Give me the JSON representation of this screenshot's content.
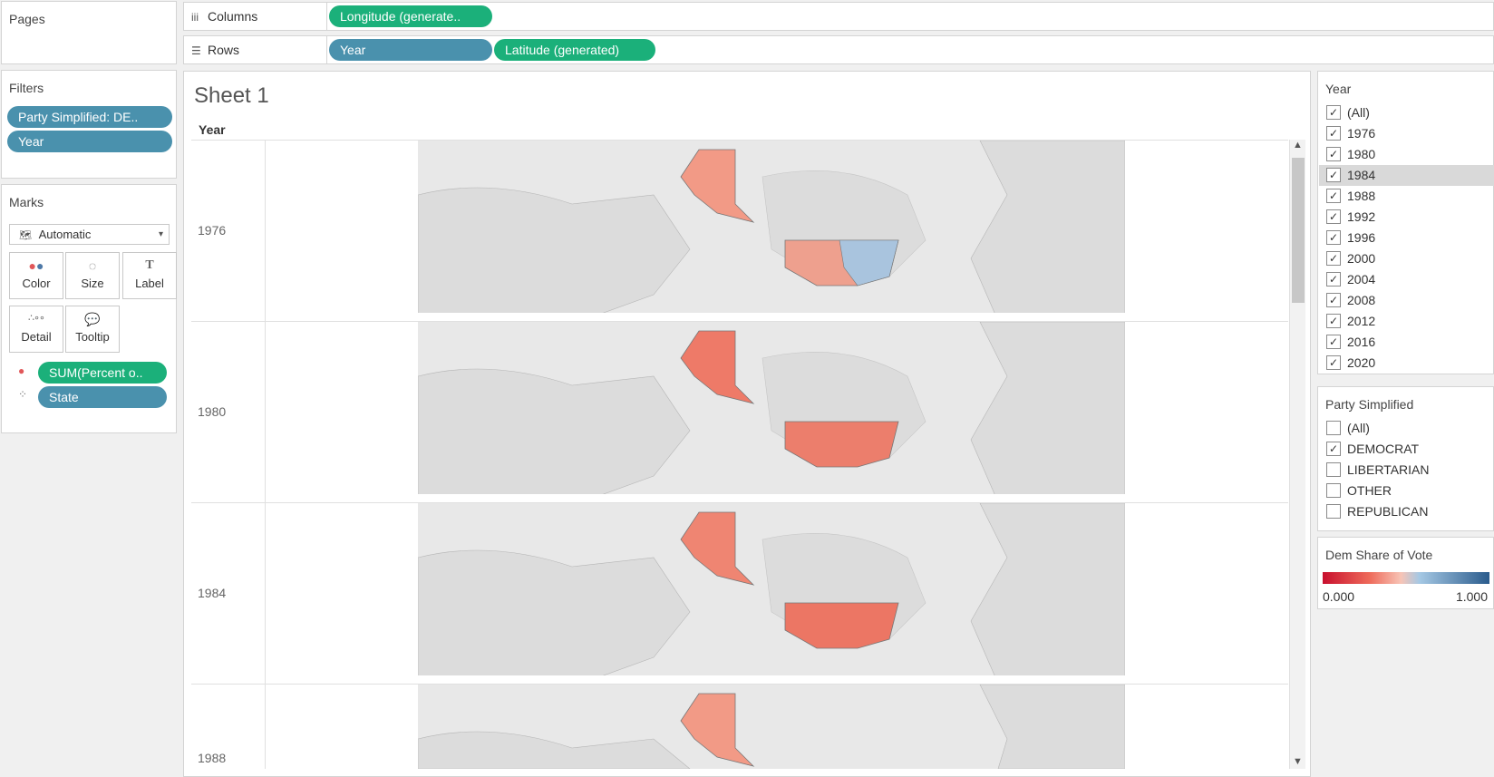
{
  "pages_panel": {
    "title": "Pages"
  },
  "shelves": {
    "columns": {
      "label": "Columns",
      "pills": [
        "Longitude (generate.."
      ]
    },
    "rows": {
      "label": "Rows",
      "pills": [
        "Year",
        "Latitude (generated)"
      ]
    }
  },
  "filters": {
    "title": "Filters",
    "pills": [
      "Party Simplified: DE..",
      "Year"
    ]
  },
  "marks": {
    "title": "Marks",
    "mark_type": "Automatic",
    "cards": [
      "Color",
      "Size",
      "Label",
      "Detail",
      "Tooltip"
    ],
    "fields": [
      "SUM(Percent o..",
      "State"
    ]
  },
  "sheet": {
    "title": "Sheet 1",
    "row_header": "Year",
    "rows": [
      {
        "year": "1976"
      },
      {
        "year": "1980"
      },
      {
        "year": "1984"
      },
      {
        "year": "1988"
      }
    ]
  },
  "year_filter": {
    "title": "Year",
    "items": [
      {
        "label": "(All)",
        "checked": true
      },
      {
        "label": "1976",
        "checked": true
      },
      {
        "label": "1980",
        "checked": true
      },
      {
        "label": "1984",
        "checked": true,
        "highlighted": true
      },
      {
        "label": "1988",
        "checked": true
      },
      {
        "label": "1992",
        "checked": true
      },
      {
        "label": "1996",
        "checked": true
      },
      {
        "label": "2000",
        "checked": true
      },
      {
        "label": "2004",
        "checked": true
      },
      {
        "label": "2008",
        "checked": true
      },
      {
        "label": "2012",
        "checked": true
      },
      {
        "label": "2016",
        "checked": true
      },
      {
        "label": "2020",
        "checked": true
      }
    ]
  },
  "party_filter": {
    "title": "Party Simplified",
    "items": [
      {
        "label": "(All)",
        "checked": false
      },
      {
        "label": "DEMOCRAT",
        "checked": true
      },
      {
        "label": "LIBERTARIAN",
        "checked": false
      },
      {
        "label": "OTHER",
        "checked": false
      },
      {
        "label": "REPUBLICAN",
        "checked": false
      }
    ]
  },
  "legend": {
    "title": "Dem Share of Vote",
    "min": "0.000",
    "max": "1.000"
  },
  "colors": {
    "pill_blue": "#4a91ad",
    "pill_green": "#1bb07a",
    "dem_blue": "#2a5b8c",
    "rep_red": "#c8102e"
  }
}
